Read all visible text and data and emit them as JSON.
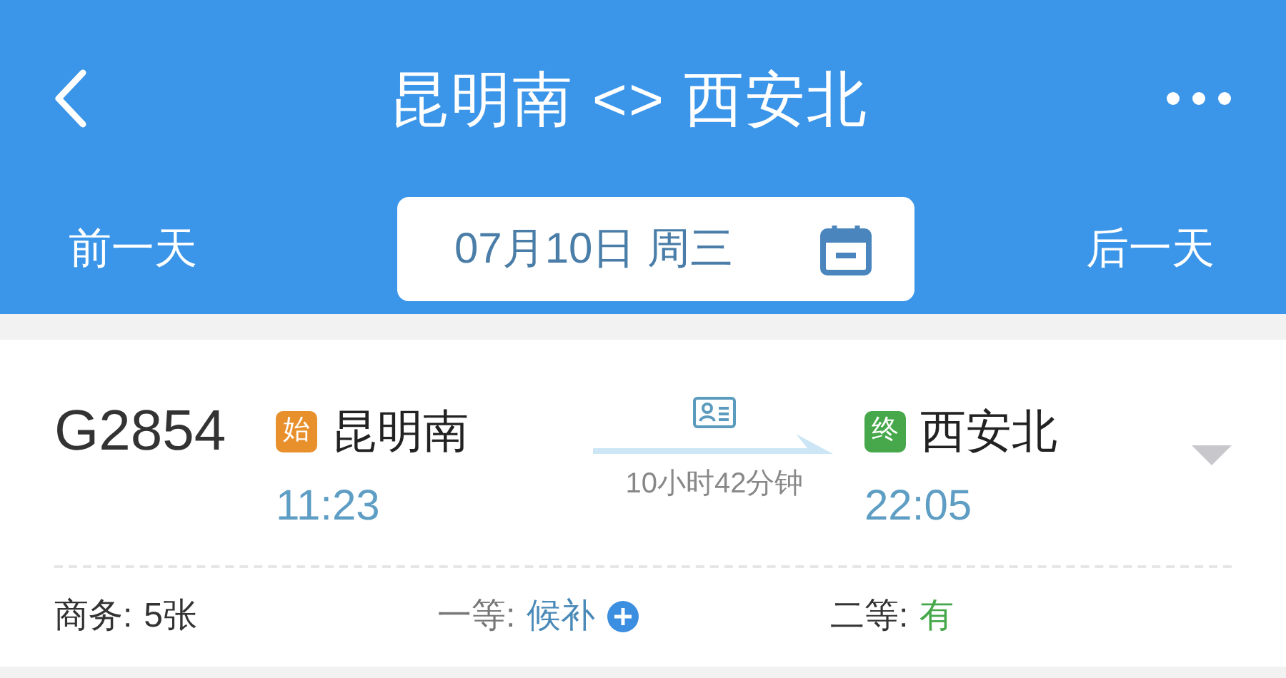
{
  "header": {
    "title": "昆明南 <> 西安北",
    "prev_day": "前一天",
    "date": "07月10日 周三",
    "next_day": "后一天"
  },
  "train": {
    "number": "G2854",
    "from": {
      "tag": "始",
      "station": "昆明南",
      "time": "11:23"
    },
    "duration": "10小时42分钟",
    "to": {
      "tag": "终",
      "station": "西安北",
      "time": "22:05"
    },
    "seats": [
      {
        "label": "商务:",
        "value": "5张",
        "kind": "count"
      },
      {
        "label": "一等:",
        "value": "候补",
        "kind": "waitlist"
      },
      {
        "label": "二等:",
        "value": "有",
        "kind": "available"
      }
    ]
  }
}
